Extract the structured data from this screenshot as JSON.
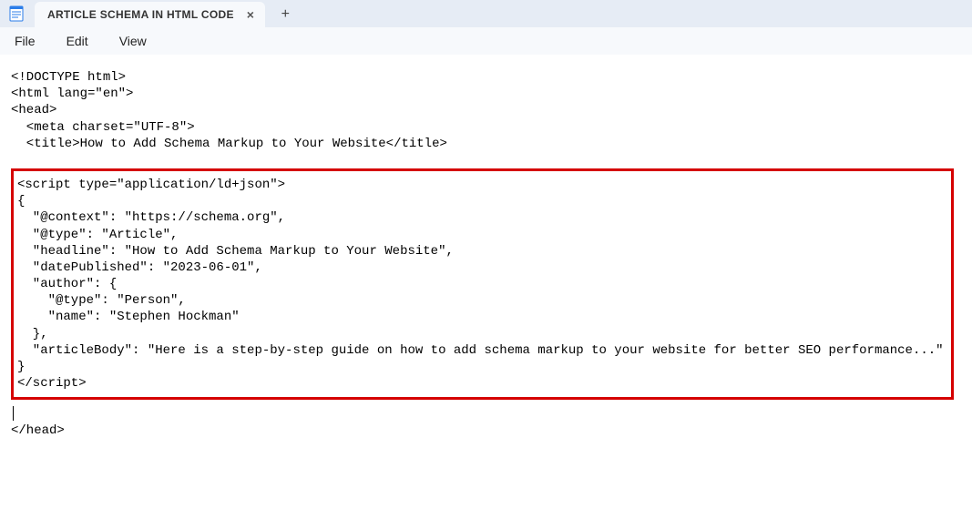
{
  "titlebar": {
    "tab_label": "ARTICLE SCHEMA IN HTML CODE",
    "close_glyph": "×",
    "newtab_glyph": "+"
  },
  "menubar": {
    "file": "File",
    "edit": "Edit",
    "view": "View"
  },
  "code": {
    "pre_lines": "<!DOCTYPE html>\n<html lang=\"en\">\n<head>\n  <meta charset=\"UTF-8\">\n  <title>How to Add Schema Markup to Your Website</title>",
    "boxed_lines": "<script type=\"application/ld+json\">\n{\n  \"@context\": \"https://schema.org\",\n  \"@type\": \"Article\",\n  \"headline\": \"How to Add Schema Markup to Your Website\",\n  \"datePublished\": \"2023-06-01\",\n  \"author\": {\n    \"@type\": \"Person\",\n    \"name\": \"Stephen Hockman\"\n  },\n  \"articleBody\": \"Here is a step-by-step guide on how to add schema markup to your website for better SEO performance...\"\n}\n</script>",
    "post_lines": "</head>"
  }
}
